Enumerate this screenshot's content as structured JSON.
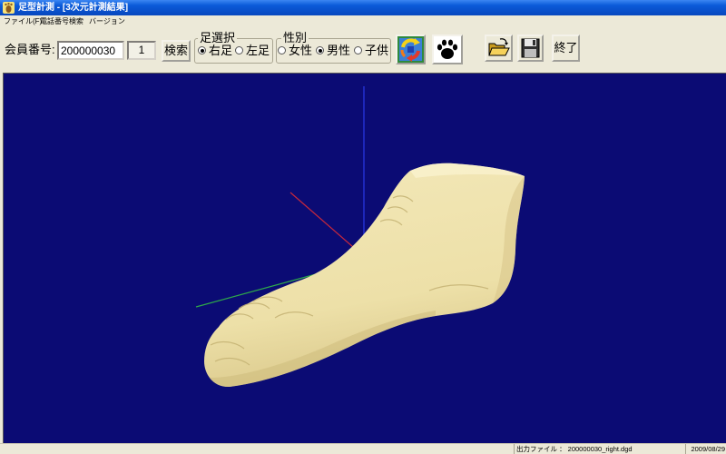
{
  "window": {
    "title": "足型計測 - [3次元計測結果]",
    "icon": "app-foot-icon"
  },
  "menu": {
    "items": [
      {
        "label": "ファイル(F)"
      },
      {
        "label": "電話番号検索"
      },
      {
        "label": "バージョン"
      }
    ]
  },
  "toolbar": {
    "member_label": "会員番号:",
    "member_number": "200000030",
    "count": "1",
    "search_label": "検索",
    "foot_select": {
      "legend": "足選択",
      "options": [
        {
          "label": "右足",
          "selected": true
        },
        {
          "label": "左足",
          "selected": false
        }
      ]
    },
    "gender": {
      "legend": "性別",
      "options": [
        {
          "label": "女性",
          "selected": false
        },
        {
          "label": "男性",
          "selected": true
        },
        {
          "label": "子供",
          "selected": false
        }
      ]
    },
    "icons": {
      "rotate": "rotate-view-icon",
      "paw": "paw-print-icon",
      "open": "open-folder-icon",
      "save": "save-disk-icon"
    },
    "exit_label": "終了"
  },
  "viewport": {
    "background": "#0b0b74",
    "model_color": "#f3e8b9",
    "axes": {
      "x": "#c8283c",
      "y": "#2a3ae8",
      "z": "#2ea84a"
    }
  },
  "status": {
    "output_file": "出力ファイル ： 200000030_right.dgd",
    "date": "2009/08/29"
  }
}
